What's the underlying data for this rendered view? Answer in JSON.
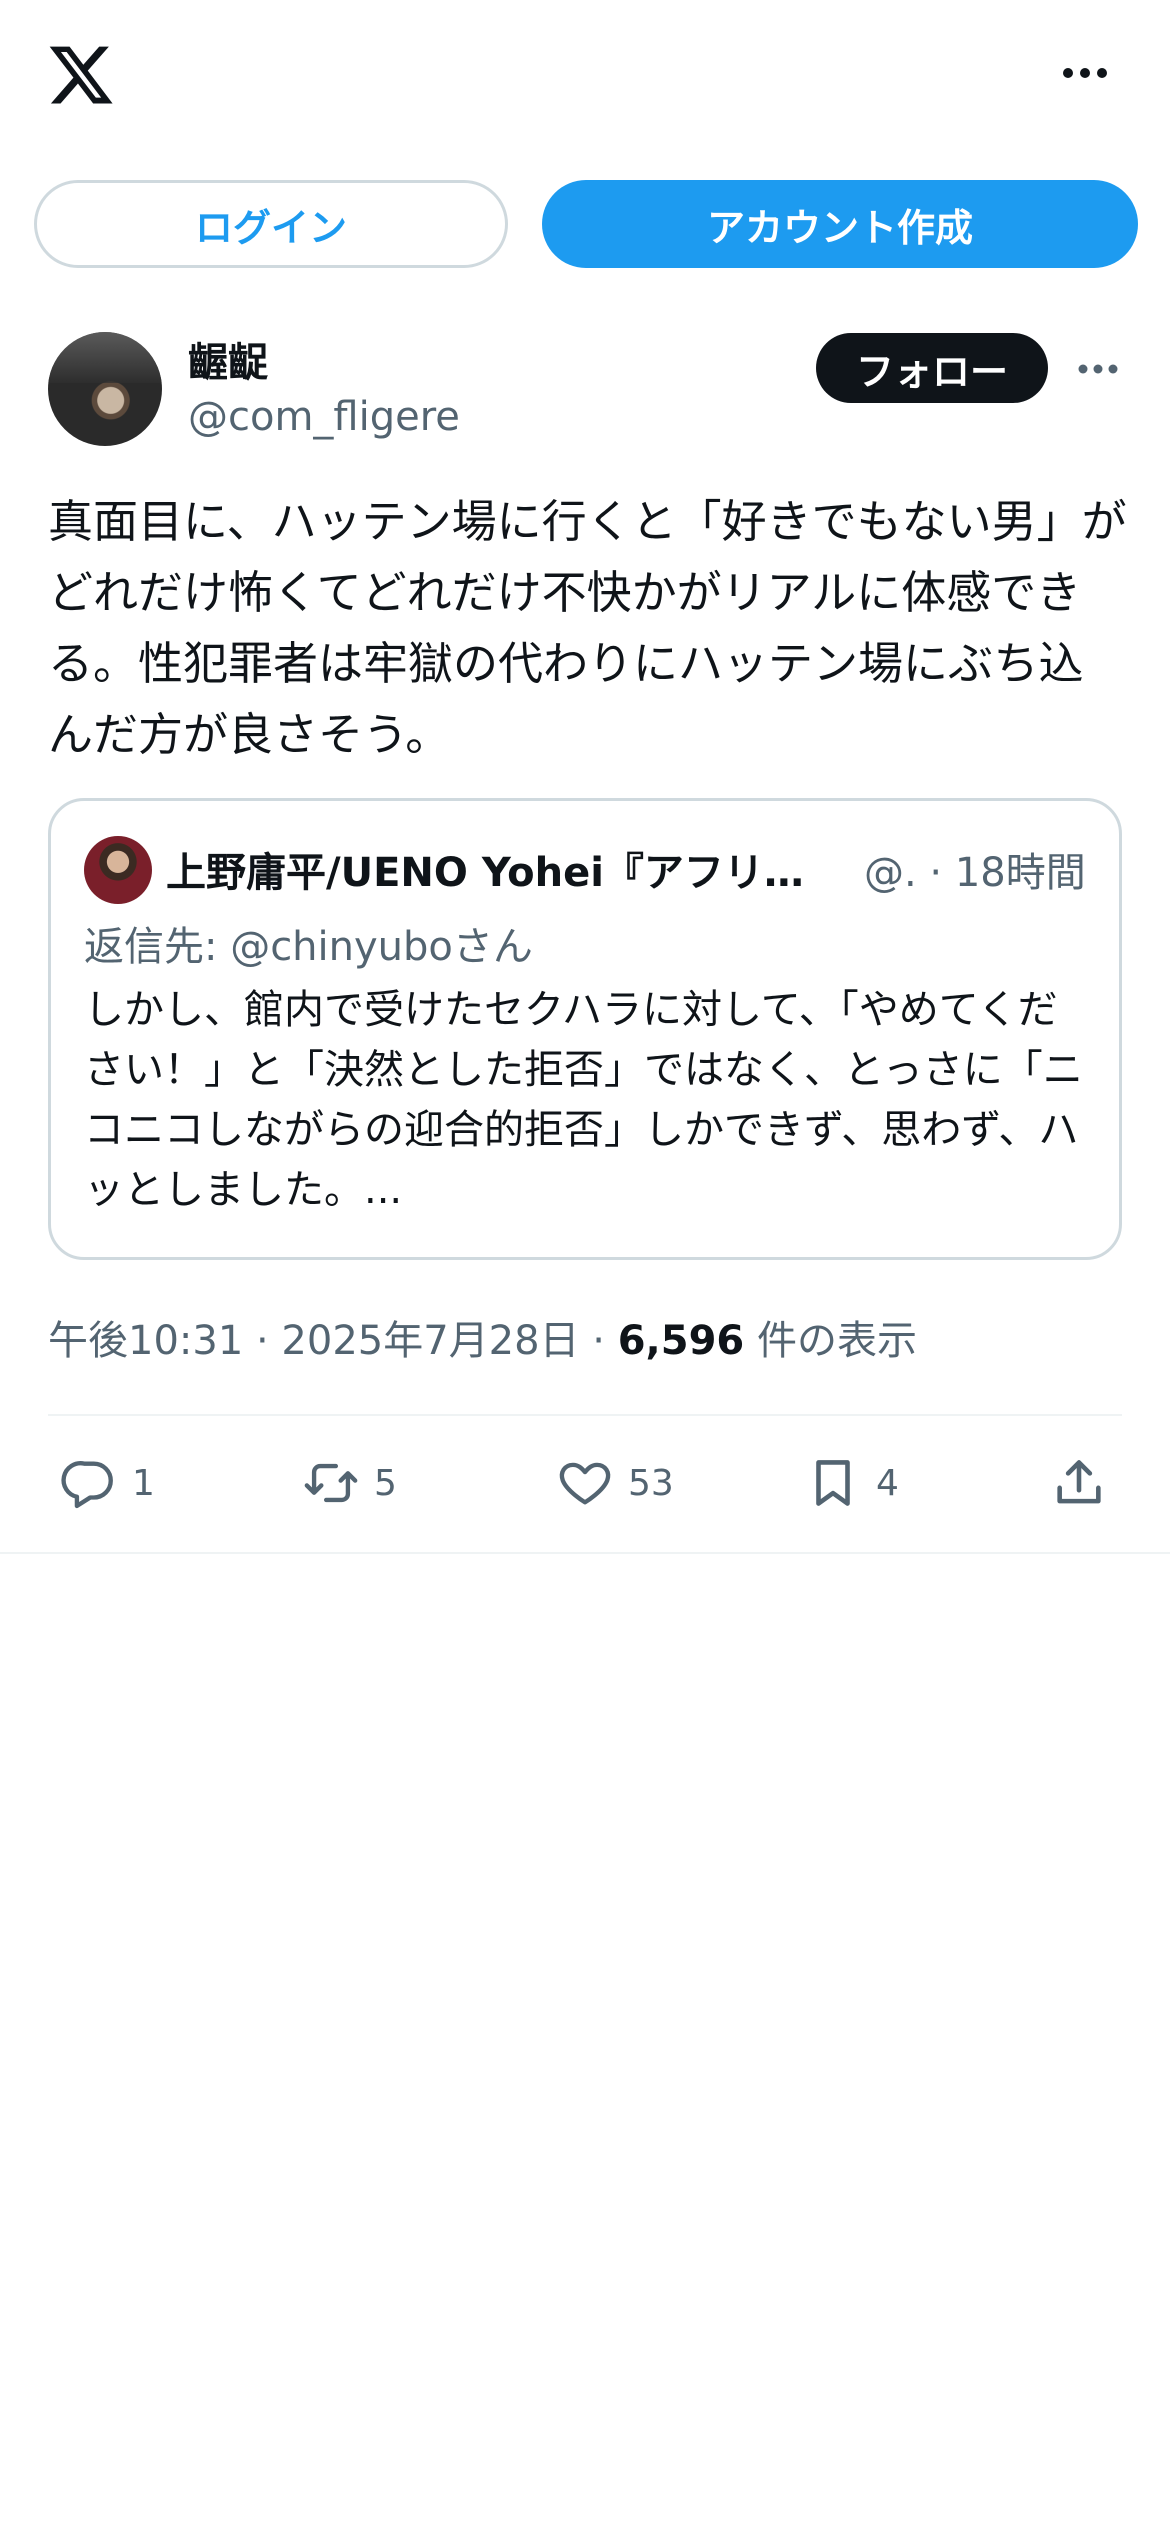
{
  "topbar": {
    "logo_icon": "x-logo-icon",
    "more_icon": "more-horizontal-icon"
  },
  "auth": {
    "login_label": "ログイン",
    "signup_label": "アカウント作成"
  },
  "author": {
    "name": "齷齪",
    "handle": "@com_fligere",
    "follow_label": "フォロー"
  },
  "tweet": {
    "text": "真面目に、ハッテン場に行くと「好きでもない男」がどれだけ怖くてどれだけ不快かがリアルに体感できる。性犯罪者は牢獄の代わりにハッテン場にぶち込んだ方が良さそう。"
  },
  "quote": {
    "name": "上野庸平/UENO Yohei『アフリカ…",
    "meta": "@. · 18時間",
    "reply_to": "返信先: @chinyuboさん",
    "body": "しかし、館内で受けたセクハラに対して、「やめてください！」と「決然とした拒否」ではなく、とっさに「ニコニコしながらの迎合的拒否」しかできず、思わず、ハッとしました。..."
  },
  "meta": {
    "time_date": "午後10:31 · 2025年7月28日 · ",
    "views_count": "6,596",
    "views_label": " 件の表示"
  },
  "actions": {
    "replies": "1",
    "retweets": "5",
    "likes": "53",
    "bookmarks": "4"
  },
  "colors": {
    "accent": "#1d9bf0",
    "text": "#0f1419",
    "secondary": "#536471",
    "border": "#cfd9de"
  }
}
